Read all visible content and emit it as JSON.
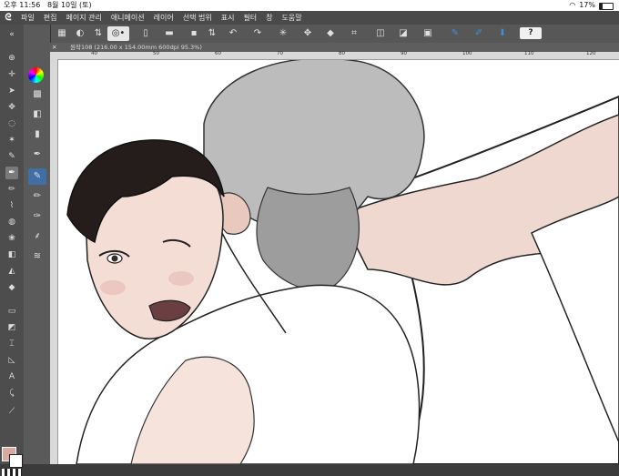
{
  "status": {
    "time": "오후 11:56",
    "date": "8월 10일 (토)",
    "battery": "17%"
  },
  "menu": [
    "파일",
    "편집",
    "페이지 관리",
    "애니메이션",
    "레이어",
    "선택 범위",
    "표시",
    "필터",
    "창",
    "도움말"
  ],
  "document_tab": "원작108 (216.00 x 154.00mm 600dpi 95.3%)",
  "ruler_labels": [
    "40",
    "50",
    "60",
    "70",
    "80",
    "90",
    "100",
    "110",
    "120"
  ],
  "toolbar_icons": [
    "grid-icon",
    "arrows-icon",
    "spiral-icon",
    "new-page-icon",
    "folder-icon",
    "layer-icon",
    "undo-icon",
    "redo-icon",
    "sparkle-icon",
    "transform-icon",
    "eraser-icon",
    "crop-icon",
    "selection-icon",
    "fill-icon",
    "brush-icon",
    "download-icon"
  ],
  "help_label": "?",
  "colors": {
    "foreground": "#d7a9a0",
    "background": "#ffffff",
    "accent": "#3c8fe0"
  }
}
